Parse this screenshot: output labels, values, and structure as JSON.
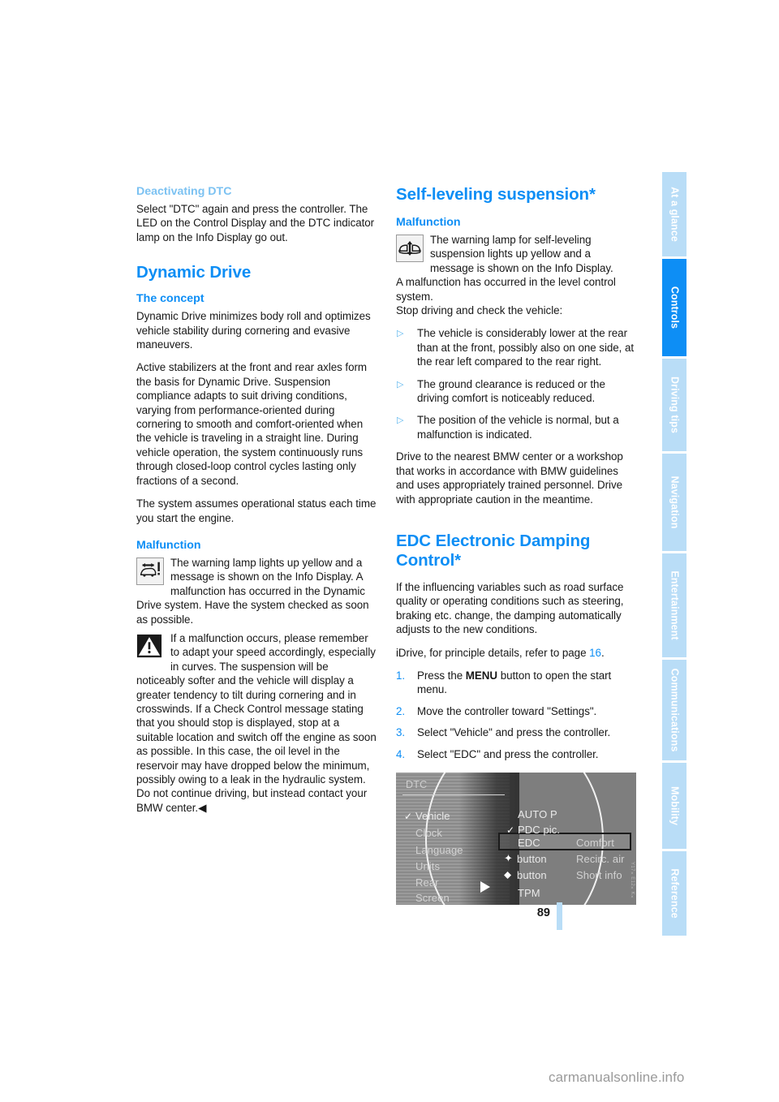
{
  "document": {
    "page_number": "89",
    "watermark": "carmanualsonline.info"
  },
  "tab_rail": {
    "items": [
      {
        "label": "At a glance",
        "active": false
      },
      {
        "label": "Controls",
        "active": true
      },
      {
        "label": "Driving tips",
        "active": false
      },
      {
        "label": "Navigation",
        "active": false
      },
      {
        "label": "Entertainment",
        "active": false
      },
      {
        "label": "Communications",
        "active": false
      },
      {
        "label": "Mobility",
        "active": false
      },
      {
        "label": "Reference",
        "active": false
      }
    ],
    "active_color": "#0d8ef5",
    "inactive_color": "#b9ddf7"
  },
  "left_column": {
    "deactivating_dtc": {
      "heading": "Deactivating DTC",
      "paragraph": "Select \"DTC\" again and press the controller. The LED on the Control Display and the DTC indicator lamp on the Info Display go out."
    },
    "dynamic_drive": {
      "title": "Dynamic Drive",
      "concept_heading": "The concept",
      "concept_p1": "Dynamic Drive minimizes body roll and optimizes vehicle stability during cornering and evasive maneuvers.",
      "concept_p2": "Active stabilizers at the front and rear axles form the basis for Dynamic Drive. Suspension compliance adapts to suit driving conditions, varying from performance-oriented during cornering to smooth and comfort-oriented when the vehicle is traveling in a straight line. During vehicle operation, the system continuously runs through closed-loop control cycles lasting only fractions of a second.",
      "concept_p3": "The system assumes operational status each time you start the engine.",
      "malfunction_heading": "Malfunction",
      "malfunction_lamp_text": "The warning lamp lights up yellow and a message is shown on the Info Display. A malfunction has occurred in the Dynamic Drive system. Have the system checked as soon as possible.",
      "warning_text": "If a malfunction occurs, please remember to adapt your speed accordingly, especially in curves. The suspension will be noticeably softer and the vehicle will display a greater tendency to tilt during cornering and in crosswinds. If a Check Control message stating that you should stop is displayed, stop at a suitable location and switch off the engine as soon as possible. In this case, the oil level in the reservoir may have dropped below the minimum, possibly owing to a leak in the hydraulic system. Do not continue driving, but instead contact your BMW center.",
      "end_marker": "◀"
    }
  },
  "right_column": {
    "self_leveling": {
      "title": "Self-leveling suspension*",
      "malfunction_heading": "Malfunction",
      "lamp_text": "The warning lamp for self-leveling suspension lights up yellow and a message is shown on the Info Display.",
      "lamp_followup": "A malfunction has occurred in the level control system.",
      "instruction": "Stop driving and check the vehicle:",
      "bullets": [
        "The vehicle is considerably lower at the rear than at the front, possibly also on one side, at the rear left compared to the rear right.",
        "The ground clearance is reduced or the driving comfort is noticeably reduced.",
        "The position of the vehicle is normal, but a malfunction is indicated."
      ],
      "closing": "Drive to the nearest BMW center or a workshop that works in accordance with BMW guidelines and uses appropriately trained personnel. Drive with appropriate caution in the meantime."
    },
    "edc": {
      "title": "EDC Electronic Damping Control*",
      "intro": "If the influencing variables such as road surface quality or operating conditions such as steering, braking etc. change, the damping automatically adjusts to the new conditions.",
      "idrive_ref_prefix": "iDrive, for principle details, refer to page ",
      "idrive_ref_page": "16",
      "idrive_ref_suffix": ".",
      "steps": [
        {
          "number": "1.",
          "prefix": "Press the ",
          "emphasis": "MENU",
          "suffix": " button to open the start menu."
        },
        {
          "number": "2.",
          "prefix": "Move the controller toward \"Settings\".",
          "emphasis": "",
          "suffix": ""
        },
        {
          "number": "3.",
          "prefix": "Select \"Vehicle\" and press the controller.",
          "emphasis": "",
          "suffix": ""
        },
        {
          "number": "4.",
          "prefix": "Select \"EDC\" and press the controller.",
          "emphasis": "",
          "suffix": ""
        }
      ]
    },
    "idrive_figure": {
      "header": "DTC",
      "left_menu": [
        {
          "label": "Vehicle",
          "checked": true
        },
        {
          "label": "Clock",
          "checked": false
        },
        {
          "label": "Language",
          "checked": false
        },
        {
          "label": "Units",
          "checked": false
        },
        {
          "label": "Rear",
          "checked": false
        },
        {
          "label": "Screen",
          "checked": false
        }
      ],
      "right_menu": [
        {
          "label": "AUTO P",
          "value": "",
          "checked": false,
          "glyph": "",
          "highlighted": false
        },
        {
          "label": "PDC pic.",
          "value": "",
          "checked": true,
          "glyph": "",
          "highlighted": false
        },
        {
          "label": "EDC",
          "value": "Comfort",
          "checked": false,
          "glyph": "",
          "highlighted": true
        },
        {
          "label": "button",
          "value": "Recirc. air",
          "checked": false,
          "glyph": "star",
          "highlighted": false
        },
        {
          "label": "button",
          "value": "Short info",
          "checked": false,
          "glyph": "diamond",
          "highlighted": false
        },
        {
          "label": "TPM",
          "value": "",
          "checked": false,
          "glyph": "",
          "highlighted": false
        }
      ],
      "caption_code": "Y17×E12×K×"
    }
  }
}
